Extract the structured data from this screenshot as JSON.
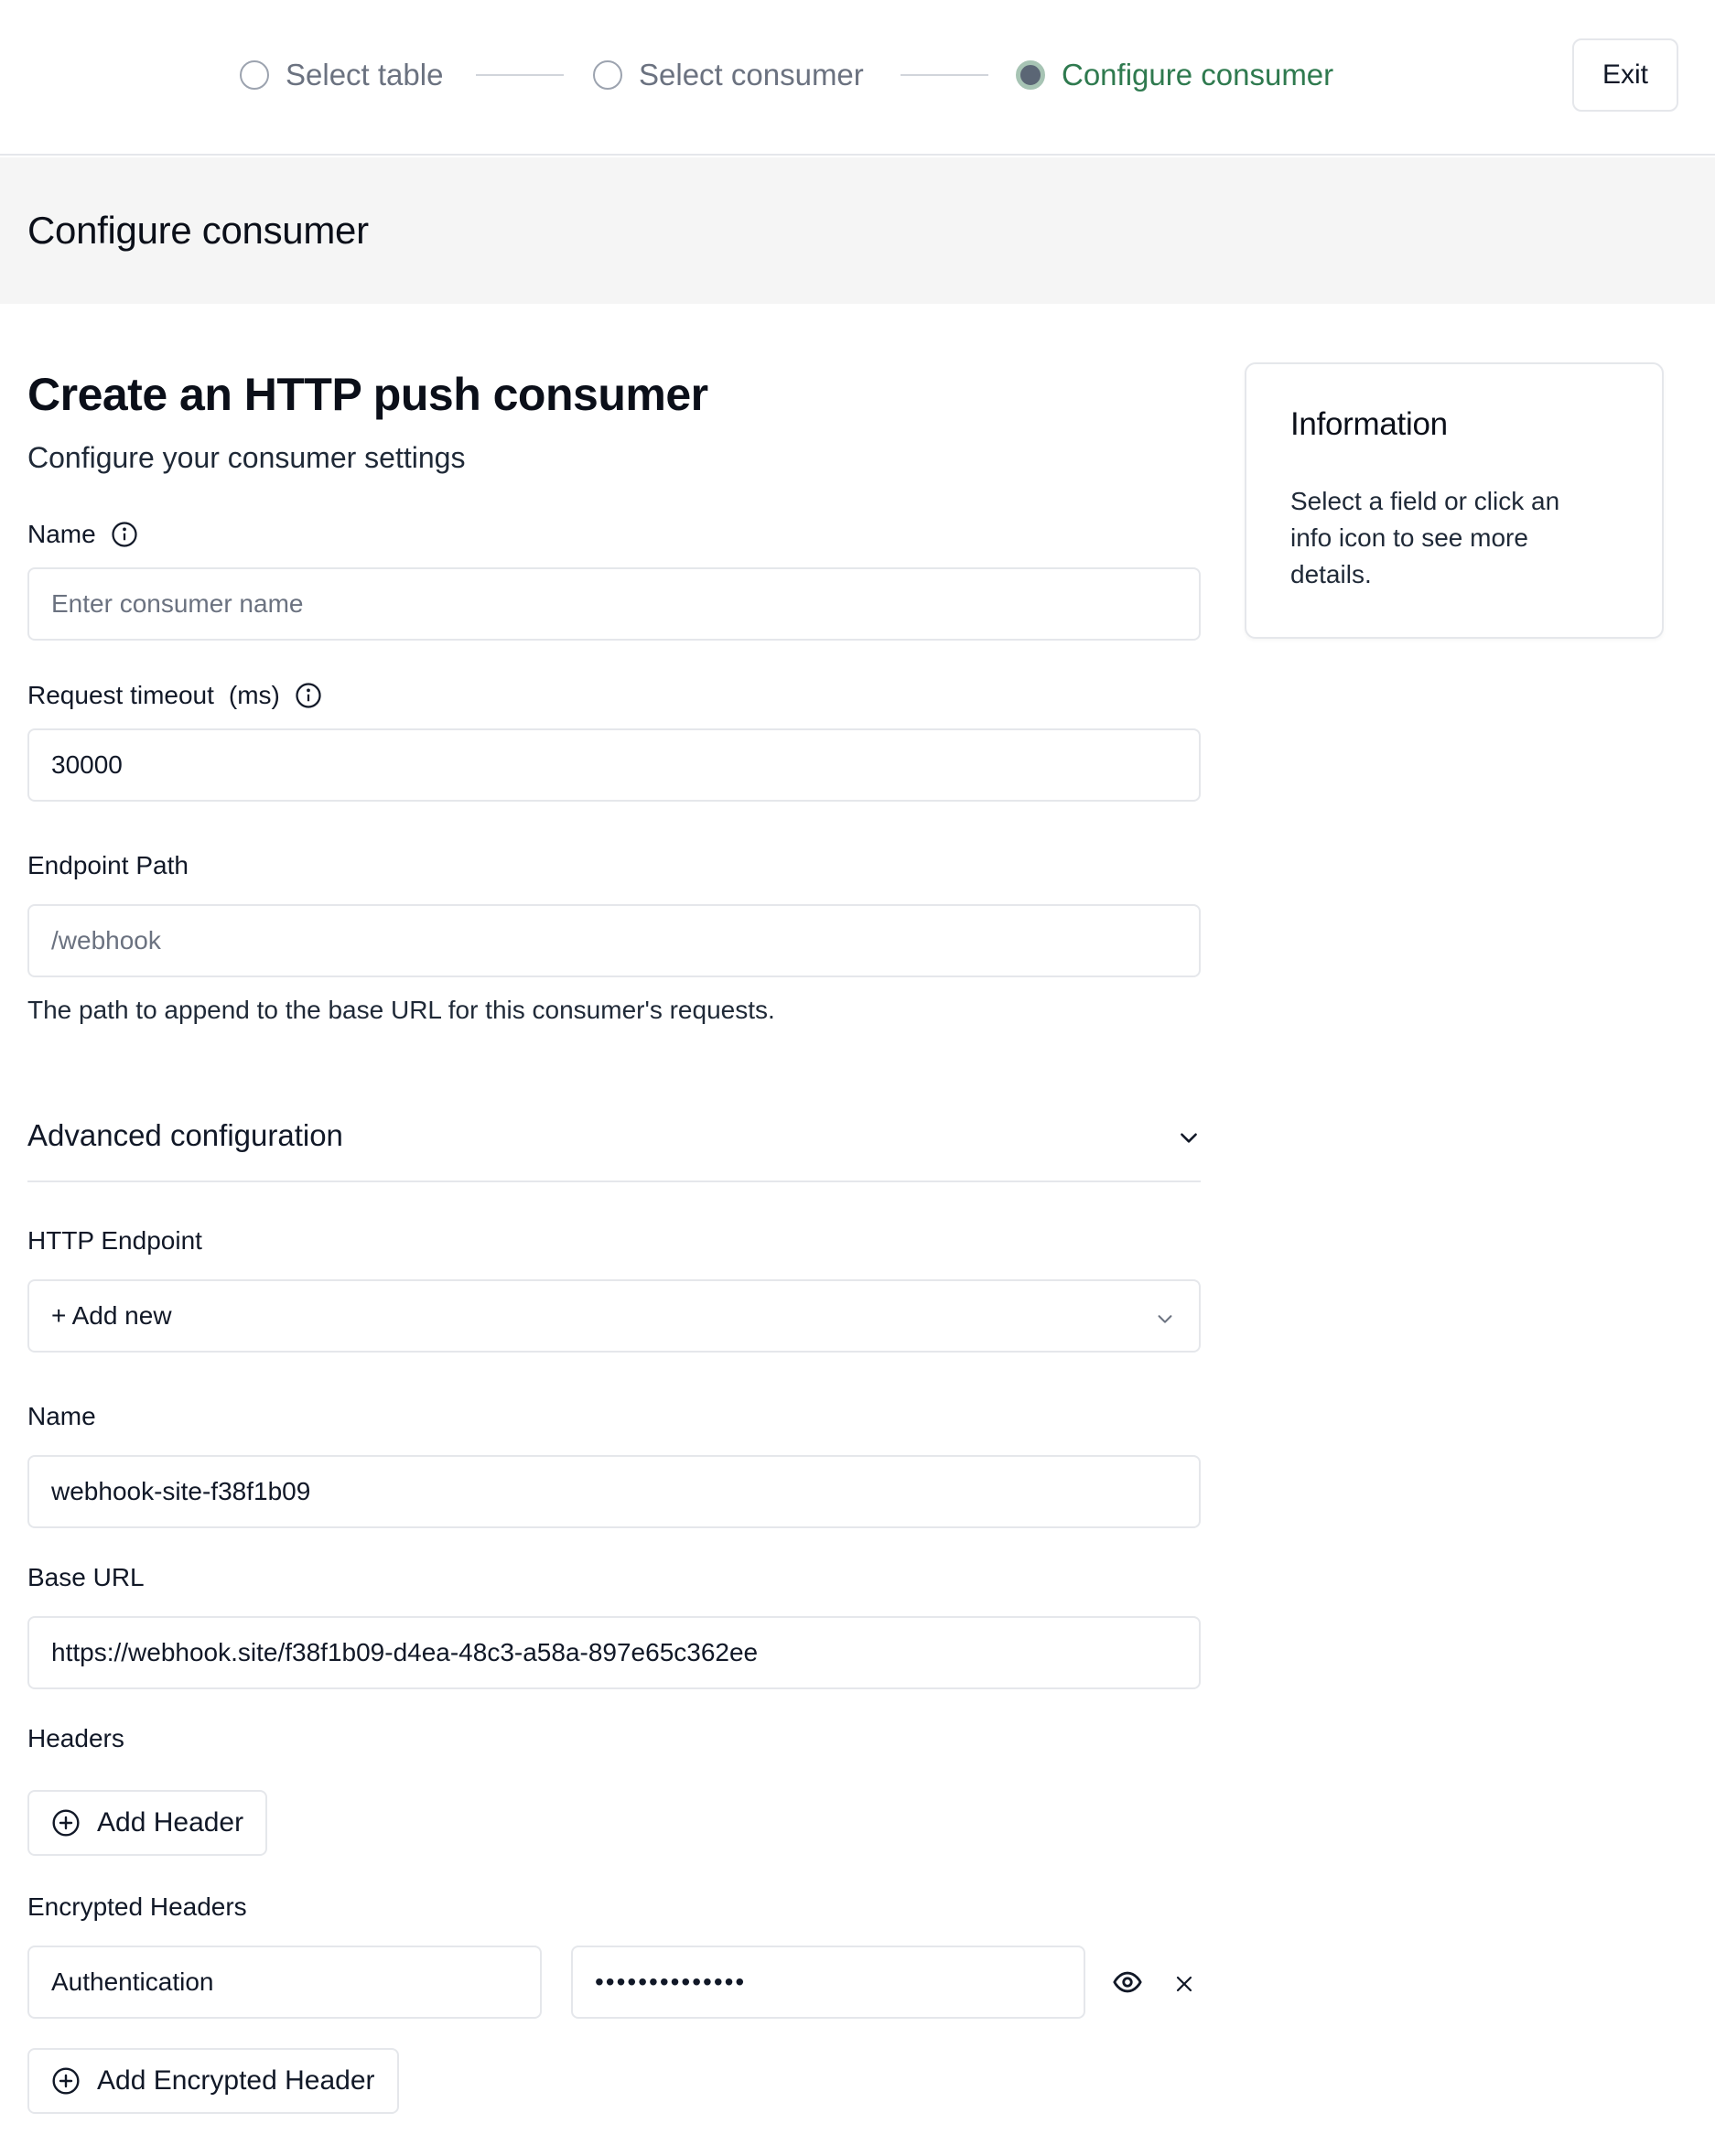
{
  "stepper": {
    "steps": [
      {
        "label": "Select table",
        "state": "inactive"
      },
      {
        "label": "Select consumer",
        "state": "inactive"
      },
      {
        "label": "Configure consumer",
        "state": "active"
      }
    ],
    "exit_label": "Exit"
  },
  "section": {
    "title": "Configure consumer"
  },
  "form": {
    "title": "Create an HTTP push consumer",
    "subtitle": "Configure your consumer settings",
    "name": {
      "label": "Name",
      "placeholder": "Enter consumer name",
      "value": ""
    },
    "timeout": {
      "label": "Request timeout",
      "unit": "(ms)",
      "value": "30000"
    },
    "endpoint_path": {
      "label": "Endpoint Path",
      "placeholder": "/webhook",
      "helper": "The path to append to the base URL for this consumer's requests."
    },
    "advanced": {
      "label": "Advanced configuration"
    },
    "http_endpoint": {
      "label": "HTTP Endpoint",
      "selected": "+ Add new"
    },
    "endpoint_name": {
      "label": "Name",
      "value": "webhook-site-f38f1b09"
    },
    "base_url": {
      "label": "Base URL",
      "value": "https://webhook.site/f38f1b09-d4ea-48c3-a58a-897e65c362ee"
    },
    "headers": {
      "label": "Headers",
      "add_label": "Add Header"
    },
    "encrypted_headers": {
      "label": "Encrypted Headers",
      "rows": [
        {
          "key": "Authentication",
          "value_masked": "••••••••••••••"
        }
      ],
      "add_label": "Add Encrypted Header"
    }
  },
  "info_panel": {
    "title": "Information",
    "body": "Select a field or click an info icon to see more details."
  },
  "colors": {
    "accent_green": "#2f7a4f",
    "border": "#e5e7eb",
    "header_bg": "#f5f5f5"
  }
}
